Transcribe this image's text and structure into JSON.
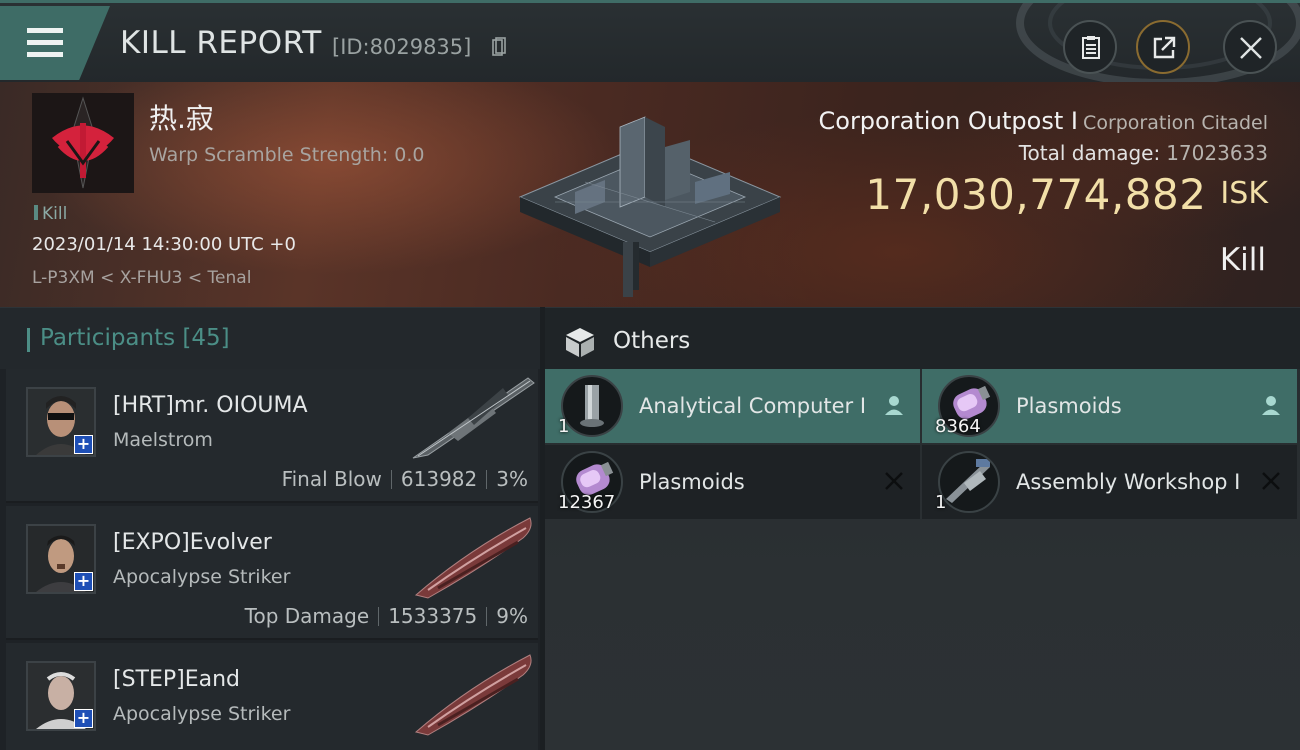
{
  "header": {
    "title": "KILL REPORT",
    "report_id": "[ID:8029835]"
  },
  "victim": {
    "name": "热.寂",
    "warp_scramble": "Warp Scramble Strength: 0.0",
    "kill_tag": "Kill",
    "datetime": "2023/01/14 14:30:00 UTC +0",
    "location": "L-P3XM < X-FHU3 < Tenal"
  },
  "ship": {
    "name": "Corporation Outpost I",
    "group": "Corporation Citadel",
    "damage_label": "Total damage:",
    "damage_value": "17023633",
    "isk_value": "17,030,774,882",
    "isk_unit": "ISK",
    "result": "Kill"
  },
  "participants": {
    "title": "Participants",
    "count": "[45]",
    "rows": [
      {
        "name": "[HRT]mr. OIOUMA",
        "ship": "Maelstrom",
        "role": "Final Blow",
        "damage": "613982",
        "percent": "3%"
      },
      {
        "name": "[EXPO]Evolver",
        "ship": "Apocalypse Striker",
        "role": "Top Damage",
        "damage": "1533375",
        "percent": "9%"
      },
      {
        "name": "[STEP]Eand",
        "ship": "Apocalypse Striker",
        "role": "",
        "damage": "",
        "percent": ""
      }
    ]
  },
  "others": {
    "title": "Others",
    "items": [
      {
        "name": "Analytical Computer I",
        "qty": "1",
        "status": "person-icon",
        "selected": true
      },
      {
        "name": "Plasmoids",
        "qty": "8364",
        "status": "person-icon",
        "selected": true
      },
      {
        "name": "Plasmoids",
        "qty": "12367",
        "status": "destroyed-x-icon",
        "selected": false
      },
      {
        "name": "Assembly Workshop I",
        "qty": "1",
        "status": "destroyed-x-icon",
        "selected": false
      }
    ]
  },
  "colors": {
    "accent_teal": "#3e6c66",
    "isk_gold": "#f2dfa8",
    "participants_header": "#4b8e86"
  }
}
